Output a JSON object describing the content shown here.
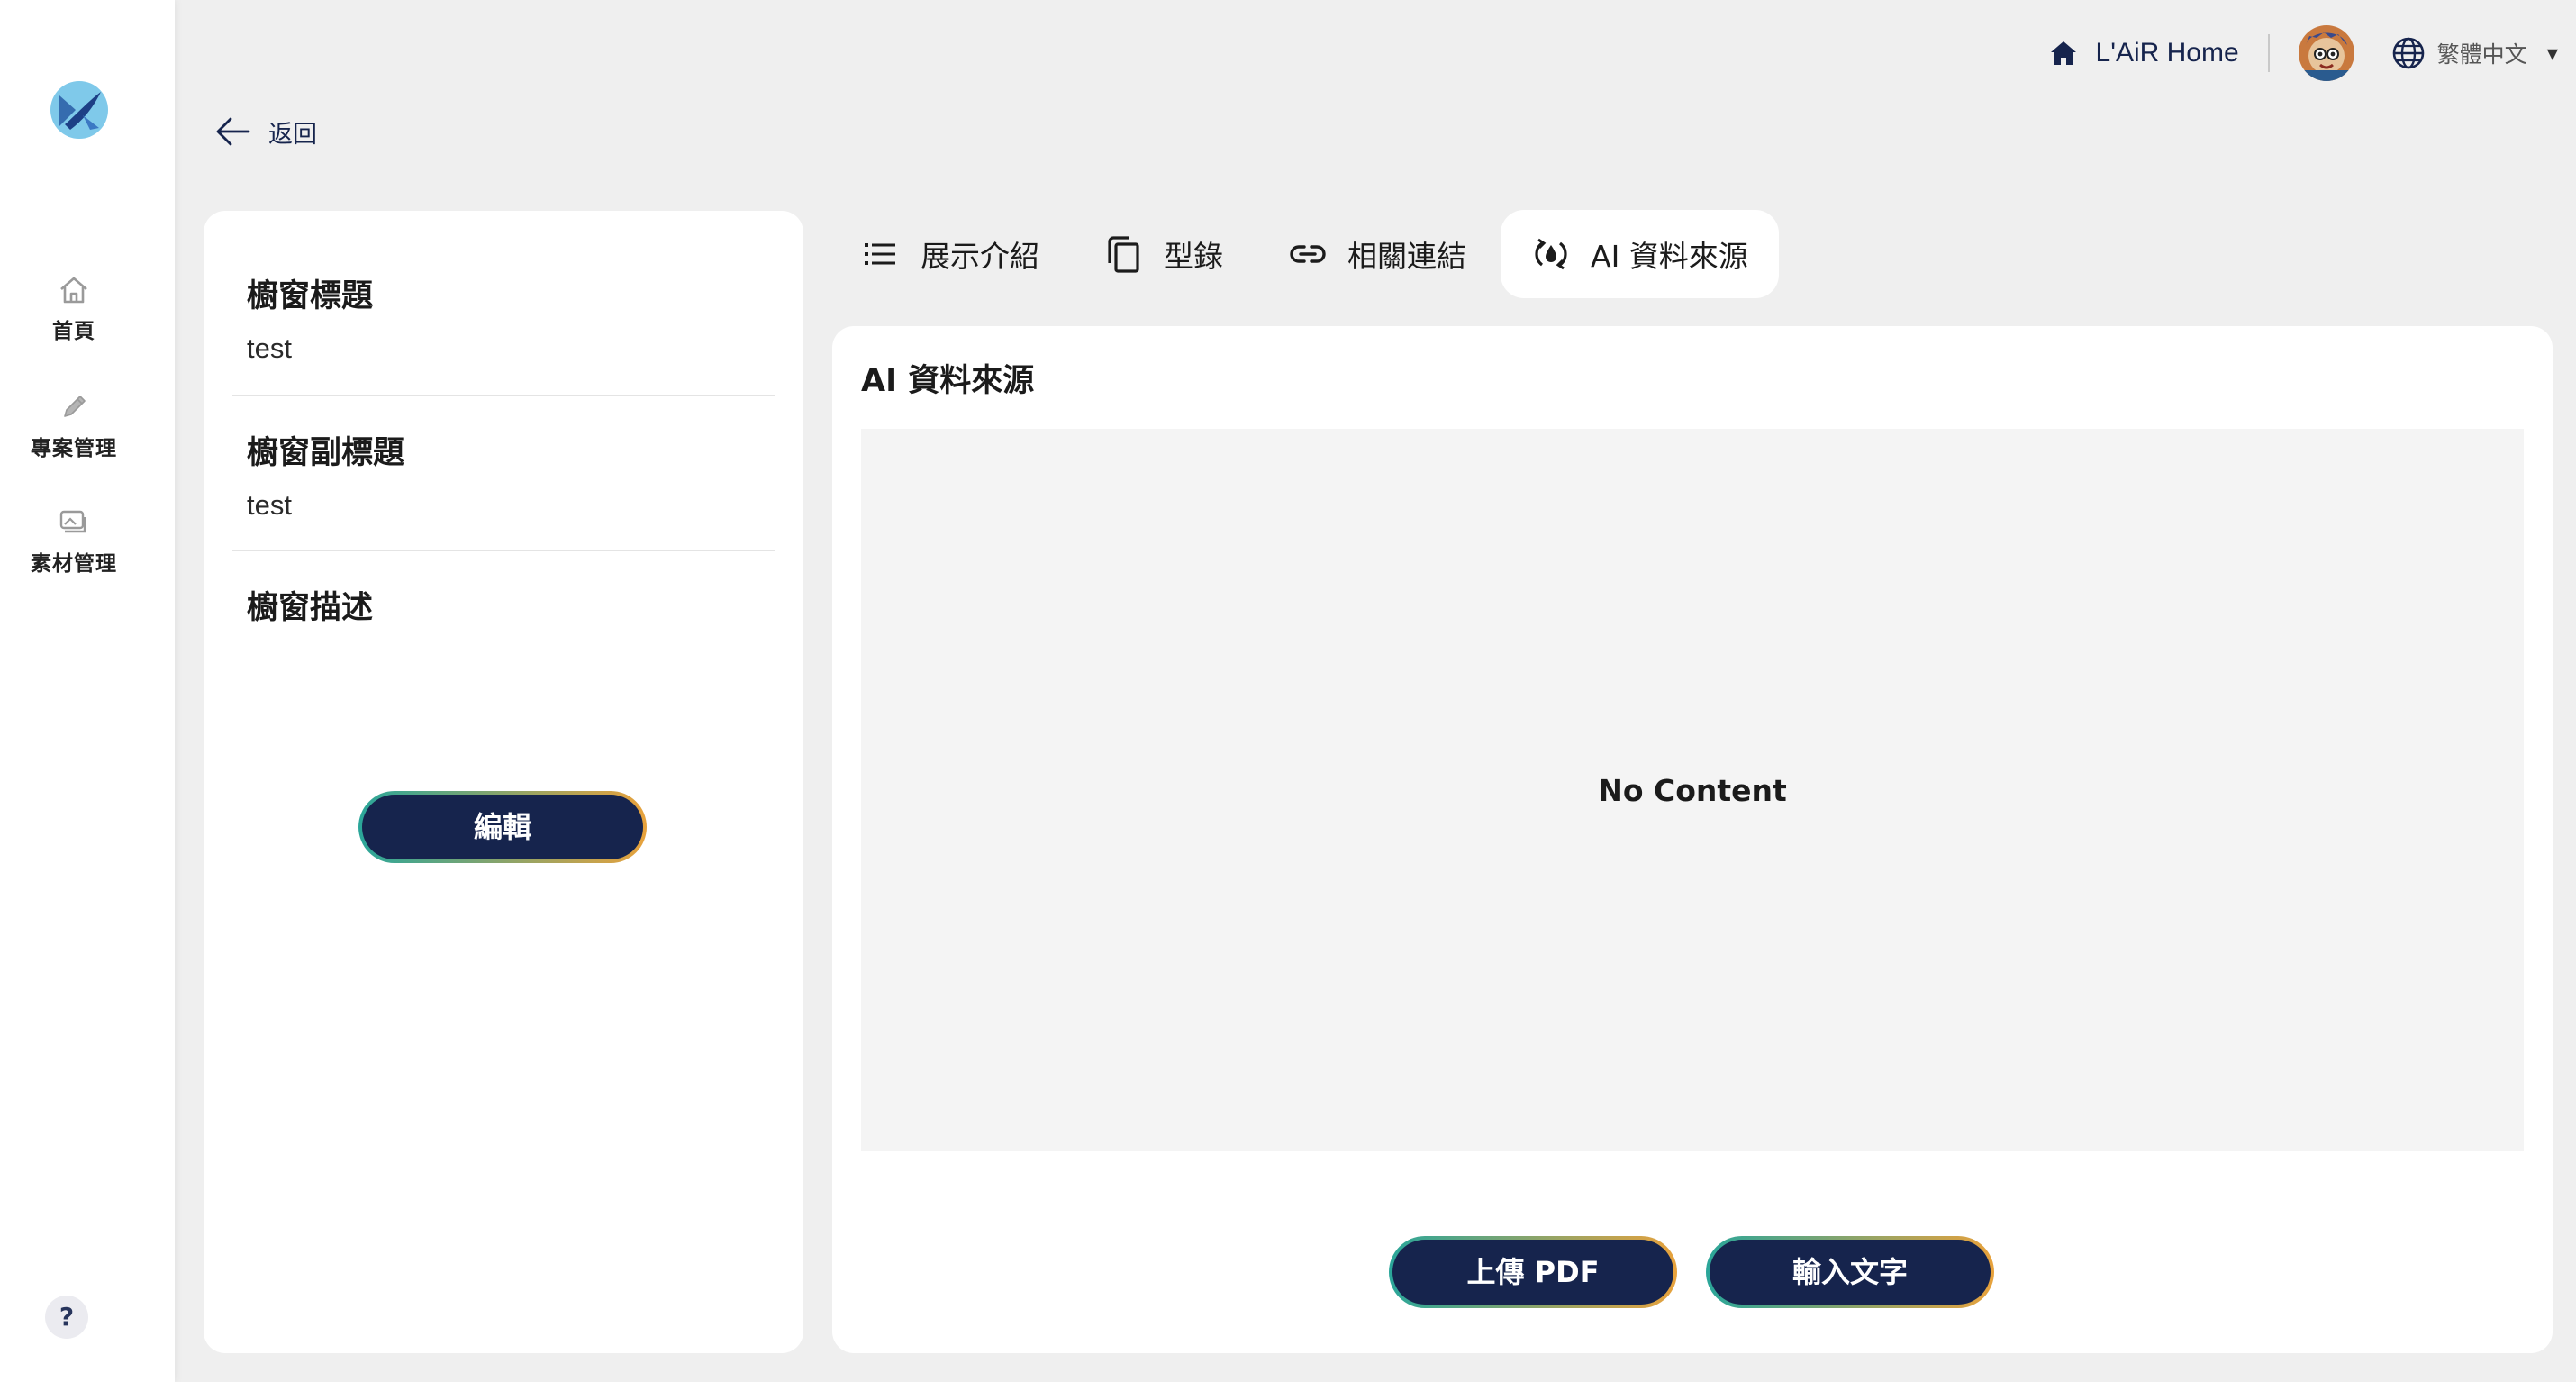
{
  "sidebar": {
    "items": [
      {
        "label": "首頁",
        "icon": "home-icon"
      },
      {
        "label": "專案管理",
        "icon": "pencil-icon"
      },
      {
        "label": "素材管理",
        "icon": "media-icon"
      }
    ],
    "help_label": "?"
  },
  "header": {
    "home_label": "L'AiR Home",
    "language": "繁體中文",
    "caret": "▼"
  },
  "back_label": "返回",
  "info": {
    "title_label": "櫥窗標題",
    "title_value": "test",
    "subtitle_label": "櫥窗副標題",
    "subtitle_value": "test",
    "description_label": "櫥窗描述",
    "edit_label": "編輯"
  },
  "tabs": [
    {
      "label": "展示介紹",
      "icon": "list-icon"
    },
    {
      "label": "型錄",
      "icon": "copy-icon"
    },
    {
      "label": "相關連結",
      "icon": "link-icon"
    },
    {
      "label": "AI 資料來源",
      "icon": "ai-source-icon",
      "active": true
    }
  ],
  "panel": {
    "title": "AI 資料來源",
    "empty_text": "No Content",
    "upload_pdf_label": "上傳 PDF",
    "input_text_label": "輸入文字"
  },
  "colors": {
    "primary": "#16244d",
    "gradient_start": "#2aa69a",
    "gradient_end": "#e8a23c",
    "background": "#efefef"
  }
}
